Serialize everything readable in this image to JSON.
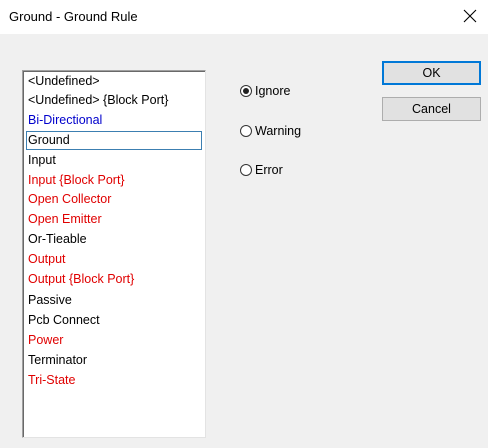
{
  "window": {
    "title": "Ground - Ground Rule",
    "close_icon": "close-icon"
  },
  "list": {
    "items": [
      {
        "label": "<Undefined>",
        "color": "#000000"
      },
      {
        "label": "<Undefined> {Block Port}",
        "color": "#000000"
      },
      {
        "label": "Bi-Directional",
        "color": "#0000cc"
      },
      {
        "label": "Ground",
        "color": "#000000",
        "selected": true
      },
      {
        "label": "Input",
        "color": "#000000"
      },
      {
        "label": "Input {Block Port}",
        "color": "#e00000"
      },
      {
        "label": "Open Collector",
        "color": "#e00000"
      },
      {
        "label": "Open Emitter",
        "color": "#e00000"
      },
      {
        "label": "Or-Tieable",
        "color": "#000000"
      },
      {
        "label": "Output",
        "color": "#e00000"
      },
      {
        "label": "Output {Block Port}",
        "color": "#e00000"
      },
      {
        "label": "Passive",
        "color": "#000000"
      },
      {
        "label": "Pcb Connect",
        "color": "#000000"
      },
      {
        "label": "Power",
        "color": "#e00000"
      },
      {
        "label": "Terminator",
        "color": "#000000"
      },
      {
        "label": "Tri-State",
        "color": "#e00000"
      }
    ]
  },
  "options": {
    "ignore": {
      "label": "Ignore",
      "checked": true
    },
    "warning": {
      "label": "Warning",
      "checked": false
    },
    "error": {
      "label": "Error",
      "checked": false
    }
  },
  "buttons": {
    "ok": "OK",
    "cancel": "Cancel"
  }
}
